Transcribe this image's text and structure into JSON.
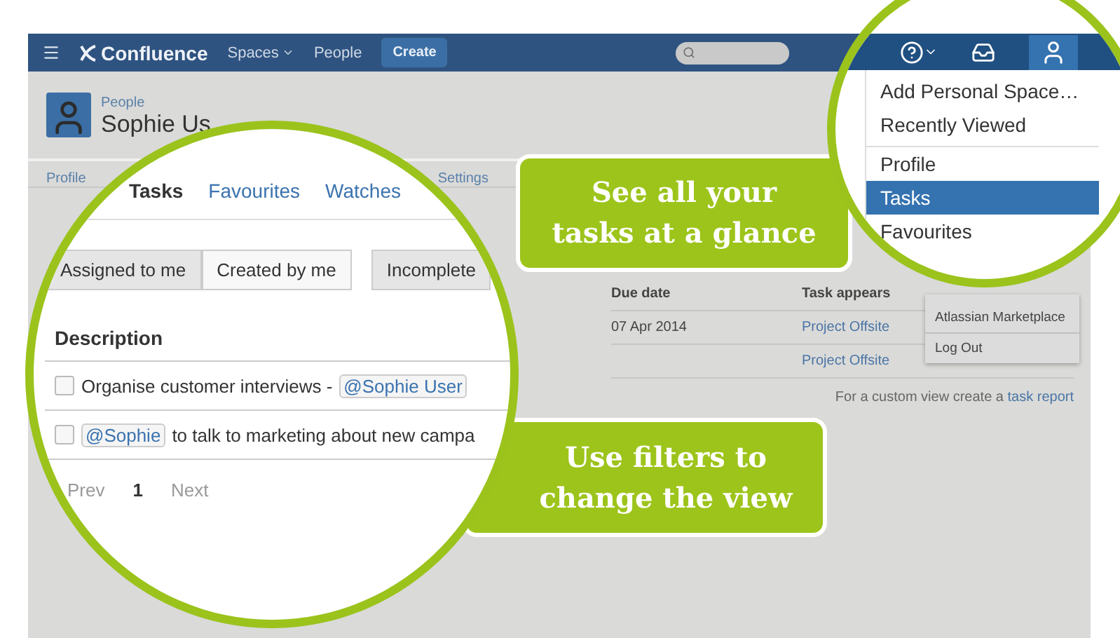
{
  "navbar": {
    "logo": "Confluence",
    "links": [
      {
        "label": "Spaces",
        "dropdown": true
      },
      {
        "label": "People",
        "dropdown": false
      }
    ],
    "create_button": "Create"
  },
  "profile": {
    "breadcrumb": "People",
    "name": "Sophie Us"
  },
  "tabs": [
    {
      "label": "Profile"
    },
    {
      "label": "Settings"
    }
  ],
  "table": {
    "columns": [
      "Due date",
      "Task appears"
    ],
    "rows": [
      {
        "due_date": "07 Apr 2014",
        "location": "Project Offsite"
      },
      {
        "location": "Project Offsite"
      }
    ]
  },
  "footer": {
    "text": "For a custom view create a",
    "link": "task report"
  },
  "background_menu": [
    "Atlassian Marketplace",
    "Log Out"
  ],
  "task_zoom": {
    "tabs": [
      {
        "label": "Tasks",
        "selected": true
      },
      {
        "label": "Favourites",
        "selected": false
      },
      {
        "label": "Watches",
        "selected": false
      }
    ],
    "filters": [
      [
        {
          "label": "Assigned to me",
          "selected": true
        },
        {
          "label": "Created by me",
          "selected": false
        }
      ],
      [
        {
          "label": "Incomplete",
          "selected": true
        }
      ]
    ],
    "column": "Description",
    "tasks": [
      {
        "checked": false,
        "parts": [
          {
            "kind": "text",
            "text": "Organise customer interviews -"
          },
          {
            "kind": "mention",
            "text": "@Sophie User"
          }
        ]
      },
      {
        "checked": false,
        "parts": [
          {
            "kind": "mention",
            "text": "@Sophie"
          },
          {
            "kind": "text",
            "text": "to talk to marketing about new campa"
          }
        ]
      }
    ],
    "pagination": {
      "prev": "Prev",
      "page": "1",
      "next": "Next"
    }
  },
  "menu_zoom": {
    "items": [
      {
        "label": "Add Personal Space…",
        "selected": false,
        "divider_before": false
      },
      {
        "label": "Recently Viewed",
        "selected": false,
        "divider_before": false
      },
      {
        "label": "Profile",
        "selected": false,
        "divider_before": true
      },
      {
        "label": "Tasks",
        "selected": true,
        "divider_before": false
      },
      {
        "label": "Favourites",
        "selected": false,
        "divider_before": false
      }
    ]
  },
  "callouts": [
    {
      "lines": [
        "See all your",
        "tasks at a glance"
      ]
    },
    {
      "lines": [
        "Use filters to",
        "change the view"
      ]
    }
  ]
}
